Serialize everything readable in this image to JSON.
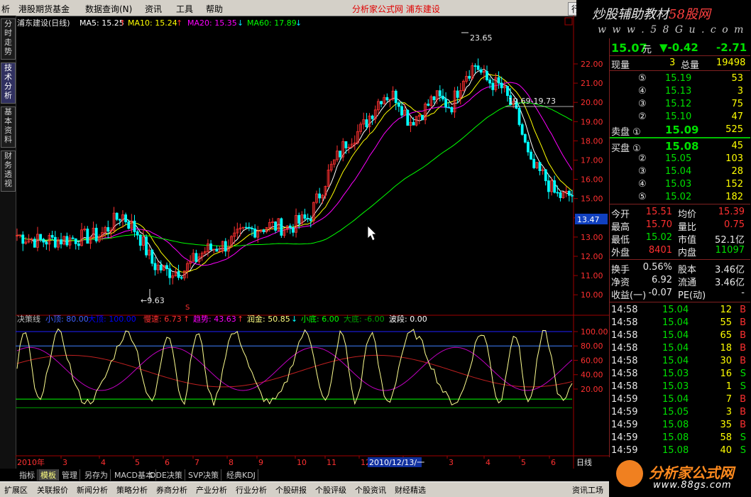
{
  "menu": {
    "items": [
      "析",
      "港股期货基金",
      "数据查询(N)",
      "资讯",
      "工具",
      "帮助"
    ],
    "center_text": "分析家公式网  浦东建设",
    "right_button": "行 情"
  },
  "watermark": {
    "line1_a": "炒股辅助教材",
    "line1_b": "58股网",
    "line2": "w w w . 5 8 G u . c o m"
  },
  "left_tabs": [
    "分时走势",
    "技术分析",
    "基本资料",
    "财务透视"
  ],
  "main_chart": {
    "header_name": "浦东建设(日线)",
    "ma": [
      {
        "label": "MA5: 15.25",
        "arrow": "↑",
        "color": "#ffffff"
      },
      {
        "label": "MA10: 15.24",
        "arrow": "↑",
        "color": "#ffff00"
      },
      {
        "label": "MA20: 15.35",
        "arrow": "↓",
        "color": "#ff00ff"
      },
      {
        "label": "MA60: 17.89",
        "arrow": "↓",
        "color": "#00ff00"
      }
    ],
    "annot_high": "23.65",
    "annot_low": "←9.63",
    "annot_level": "19.69-19.73",
    "current_price_label": "13.47",
    "y_ticks": [
      "22.00",
      "21.00",
      "20.00",
      "19.00",
      "18.00",
      "17.00",
      "16.00",
      "15.00",
      "14.00",
      "13.00",
      "12.00",
      "11.00",
      "10.00"
    ],
    "s_marker": "S",
    "minimize_icon_label": "▭",
    "colors": {
      "grid_red": "#a00000",
      "bg": "#000000"
    }
  },
  "indicator": {
    "header": [
      {
        "text": "决策线",
        "color": "#c0c0c0"
      },
      {
        "text": "小顶: 80.00",
        "color": "#4060ff"
      },
      {
        "text": "大顶: 100.00",
        "color": "#0000ff"
      },
      {
        "text": "慢速: 6.73",
        "color": "#ff3030"
      },
      {
        "text": "↑",
        "color": "#ff3030"
      },
      {
        "text": "趋势: 43.63",
        "color": "#ff00ff"
      },
      {
        "text": "↑",
        "color": "#ff3030"
      },
      {
        "text": "润金: 50.85",
        "color": "#ffff80"
      },
      {
        "text": "↓",
        "color": "#00ffff"
      },
      {
        "text": "小底: 6.00",
        "color": "#00ff00"
      },
      {
        "text": "大底: -6.00",
        "color": "#00a000"
      },
      {
        "text": "波段: 0.00",
        "color": "#ffffff"
      }
    ],
    "y_ticks": [
      "100.00",
      "80.00",
      "60.00",
      "40.00",
      "20.00"
    ]
  },
  "x_axis": {
    "labels": [
      "2010年",
      "3",
      "4",
      "5",
      "6",
      "7",
      "8",
      "9",
      "10",
      "11",
      "12",
      "2",
      "3",
      "4",
      "5",
      "6"
    ],
    "cursor_date": "2010/12/13/一",
    "unit_label": "日线"
  },
  "quote": {
    "price": "15.07",
    "unit": "元",
    "change": "▼-0.42",
    "change_pct": "-2.71",
    "xianliang_label": "现量",
    "xianliang": "3",
    "zongliang_label": "总量",
    "zongliang": "19498",
    "sell": [
      {
        "lvl": "⑤",
        "price": "15.19",
        "vol": "53"
      },
      {
        "lvl": "④",
        "price": "15.13",
        "vol": "3"
      },
      {
        "lvl": "③",
        "price": "15.12",
        "vol": "75"
      },
      {
        "lvl": "②",
        "price": "15.10",
        "vol": "47"
      },
      {
        "lvl": "卖盘 ①",
        "price": "15.09",
        "vol": "525"
      }
    ],
    "buy": [
      {
        "lvl": "买盘 ①",
        "price": "15.08",
        "vol": "45"
      },
      {
        "lvl": "②",
        "price": "15.05",
        "vol": "103"
      },
      {
        "lvl": "③",
        "price": "15.04",
        "vol": "28"
      },
      {
        "lvl": "④",
        "price": "15.03",
        "vol": "152"
      },
      {
        "lvl": "⑤",
        "price": "15.02",
        "vol": "182"
      }
    ],
    "stats": [
      {
        "l1": "今开",
        "v1": "15.51",
        "c1": "red",
        "l2": "均价",
        "v2": "15.39",
        "c2": "red"
      },
      {
        "l1": "最高",
        "v1": "15.70",
        "c1": "red",
        "l2": "量比",
        "v2": "0.75",
        "c2": "red"
      },
      {
        "l1": "最低",
        "v1": "15.02",
        "c1": "grn",
        "l2": "市值",
        "v2": "52.1亿",
        "c2": "wht"
      },
      {
        "l1": "外盘",
        "v1": "8401",
        "c1": "red",
        "l2": "内盘",
        "v2": "11097",
        "c2": "grn"
      }
    ],
    "stats2": [
      {
        "l1": "换手",
        "v1": "0.56%",
        "l2": "股本",
        "v2": "3.46亿"
      },
      {
        "l1": "净资",
        "v1": "6.92",
        "l2": "流通",
        "v2": "3.46亿"
      },
      {
        "l1": "收益(一)",
        "v1": "-0.07",
        "l2": "PE(动)",
        "v2": "-"
      }
    ],
    "ticks": [
      {
        "t": "14:58",
        "p": "15.04",
        "v": "12",
        "s": "B"
      },
      {
        "t": "14:58",
        "p": "15.04",
        "v": "55",
        "s": "B"
      },
      {
        "t": "14:58",
        "p": "15.04",
        "v": "65",
        "s": "B"
      },
      {
        "t": "14:58",
        "p": "15.04",
        "v": "18",
        "s": "B"
      },
      {
        "t": "14:58",
        "p": "15.04",
        "v": "30",
        "s": "B"
      },
      {
        "t": "14:58",
        "p": "15.03",
        "v": "16",
        "s": "S"
      },
      {
        "t": "14:58",
        "p": "15.03",
        "v": "1",
        "s": "S"
      },
      {
        "t": "14:59",
        "p": "15.04",
        "v": "7",
        "s": "B"
      },
      {
        "t": "14:59",
        "p": "15.05",
        "v": "3",
        "s": "B"
      },
      {
        "t": "14:59",
        "p": "15.08",
        "v": "35",
        "s": "B"
      },
      {
        "t": "14:59",
        "p": "15.08",
        "v": "58",
        "s": "S"
      },
      {
        "t": "14:59",
        "p": "15.08",
        "v": "40",
        "s": "S"
      }
    ]
  },
  "bottom_tabs1": [
    "指标",
    "模板",
    "管理",
    "另存为",
    "MACD基本",
    "DDE决策",
    "SVP决策",
    "经典KDJ"
  ],
  "bottom_tabs2": [
    "扩展区",
    "关联报价",
    "新闻分析",
    "策略分析",
    "券商分析",
    "产业分析",
    "行业分析",
    "个股研报",
    "个股评级",
    "个股资讯",
    "财经精选"
  ],
  "bottom_right": "资讯工场",
  "logo2": {
    "title": "分析家公式网",
    "url": "www.88gs.com"
  }
}
